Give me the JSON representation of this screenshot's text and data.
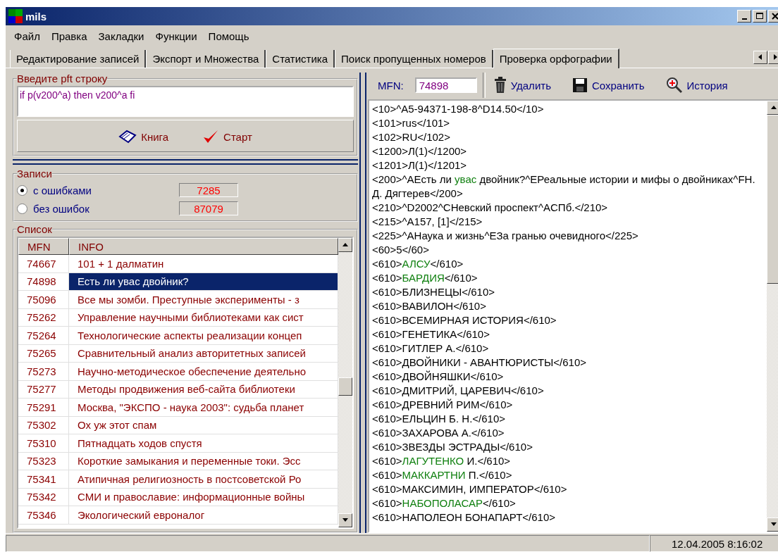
{
  "window": {
    "title": "mils"
  },
  "menu": [
    "Файл",
    "Правка",
    "Закладки",
    "Функции",
    "Помощь"
  ],
  "tabs": [
    {
      "label": "Редактирование записей",
      "selected": false
    },
    {
      "label": "Экспорт и Множества",
      "selected": false
    },
    {
      "label": "Статистика",
      "selected": false
    },
    {
      "label": "Поиск пропущенных номеров",
      "selected": false
    },
    {
      "label": "Проверка орфографии",
      "selected": true
    }
  ],
  "query": {
    "legend": "Введите pft строку",
    "value": "if p(v200^a) then v200^a fi",
    "buttons": [
      {
        "kind": "book",
        "label": "Книга"
      },
      {
        "kind": "start",
        "label": "Старт"
      }
    ]
  },
  "records": {
    "legend": "Записи",
    "options": [
      {
        "label": "с ошибками",
        "selected": true,
        "count": "7285"
      },
      {
        "label": "без ошибок",
        "selected": false,
        "count": "87079"
      }
    ]
  },
  "list": {
    "legend": "Список",
    "columns": [
      "MFN",
      "INFO"
    ],
    "rows": [
      {
        "mfn": "74667",
        "info": "101 + 1 далматин",
        "selected": false
      },
      {
        "mfn": "74898",
        "info": "Есть ли увас двойник?",
        "selected": true
      },
      {
        "mfn": "75096",
        "info": "Все мы зомби. Преступные эксперименты - з",
        "selected": false
      },
      {
        "mfn": "75262",
        "info": "Управление научными библиотеками как сист",
        "selected": false
      },
      {
        "mfn": "75264",
        "info": "Технологические аспекты реализации концеп",
        "selected": false
      },
      {
        "mfn": "75265",
        "info": "Сравнительный анализ авторитетных записей",
        "selected": false
      },
      {
        "mfn": "75273",
        "info": "Научно-методическое обеспечение деятельно",
        "selected": false
      },
      {
        "mfn": "75277",
        "info": "Методы продвижения веб-сайта библиотеки",
        "selected": false
      },
      {
        "mfn": "75291",
        "info": "Москва, \"ЭКСПО - наука 2003\": судьба планет",
        "selected": false
      },
      {
        "mfn": "75302",
        "info": "Ох уж этот спам",
        "selected": false
      },
      {
        "mfn": "75310",
        "info": "Пятнадцать ходов спустя",
        "selected": false
      },
      {
        "mfn": "75323",
        "info": "Короткие замыкания и переменные токи. Эсс",
        "selected": false
      },
      {
        "mfn": "75341",
        "info": "Атипичная религиозность в постсоветской Ро",
        "selected": false
      },
      {
        "mfn": "75342",
        "info": "СМИ и православие: информационные войны",
        "selected": false
      },
      {
        "mfn": "75346",
        "info": "Экологический евроналог",
        "selected": false
      }
    ]
  },
  "editor": {
    "mfn_label": "MFN:",
    "mfn_value": "74898",
    "buttons": [
      {
        "kind": "delete",
        "label": "Удалить"
      },
      {
        "kind": "save",
        "label": "Сохранить"
      },
      {
        "kind": "history",
        "label": "История"
      }
    ],
    "lines": [
      [
        {
          "text": "<10>^A5-94371-198-8^D14.50</10>",
          "misspelled": false
        }
      ],
      [
        {
          "text": "<101>rus</101>",
          "misspelled": false
        }
      ],
      [
        {
          "text": "<102>RU</102>",
          "misspelled": false
        }
      ],
      [
        {
          "text": "<1200>Л(1)</1200>",
          "misspelled": false
        }
      ],
      [
        {
          "text": "<1201>Л(1)</1201>",
          "misspelled": false
        }
      ],
      [
        {
          "text": "<200>^AЕсть ли ",
          "misspelled": false
        },
        {
          "text": "увас",
          "misspelled": true
        },
        {
          "text": " двойник?^EРеальные истории и мифы о двойниках^FН. Д. Дягтерев</200>",
          "misspelled": false
        }
      ],
      [
        {
          "text": "<210>^D2002^CНевский проспект^AСПб.</210>",
          "misspelled": false
        }
      ],
      [
        {
          "text": "<215>^A157, [1]</215>",
          "misspelled": false
        }
      ],
      [
        {
          "text": "<225>^AНаука и жизнь^EЗа гранью очевидного</225>",
          "misspelled": false
        }
      ],
      [
        {
          "text": "<60>5</60>",
          "misspelled": false
        }
      ],
      [
        {
          "text": "<610>",
          "misspelled": false
        },
        {
          "text": "АЛСУ",
          "misspelled": true
        },
        {
          "text": "</610>",
          "misspelled": false
        }
      ],
      [
        {
          "text": "<610>",
          "misspelled": false
        },
        {
          "text": "БАРДИЯ",
          "misspelled": true
        },
        {
          "text": "</610>",
          "misspelled": false
        }
      ],
      [
        {
          "text": "<610>БЛИЗНЕЦЫ</610>",
          "misspelled": false
        }
      ],
      [
        {
          "text": "<610>ВАВИЛОН</610>",
          "misspelled": false
        }
      ],
      [
        {
          "text": "<610>ВСЕМИРНАЯ ИСТОРИЯ</610>",
          "misspelled": false
        }
      ],
      [
        {
          "text": "<610>ГЕНЕТИКА</610>",
          "misspelled": false
        }
      ],
      [
        {
          "text": "<610>ГИТЛЕР А.</610>",
          "misspelled": false
        }
      ],
      [
        {
          "text": "<610>ДВОЙНИКИ - АВАНТЮРИСТЫ</610>",
          "misspelled": false
        }
      ],
      [
        {
          "text": "<610>ДВОЙНЯШКИ</610>",
          "misspelled": false
        }
      ],
      [
        {
          "text": "<610>ДМИТРИЙ, ЦАРЕВИЧ</610>",
          "misspelled": false
        }
      ],
      [
        {
          "text": "<610>ДРЕВНИЙ РИМ</610>",
          "misspelled": false
        }
      ],
      [
        {
          "text": "<610>ЕЛЬЦИН Б. Н.</610>",
          "misspelled": false
        }
      ],
      [
        {
          "text": "<610>ЗАХАРОВА А.</610>",
          "misspelled": false
        }
      ],
      [
        {
          "text": "<610>ЗВЕЗДЫ ЭСТРАДЫ</610>",
          "misspelled": false
        }
      ],
      [
        {
          "text": "<610>",
          "misspelled": false
        },
        {
          "text": "ЛАГУТЕНКО",
          "misspelled": true
        },
        {
          "text": " И.</610>",
          "misspelled": false
        }
      ],
      [
        {
          "text": "<610>",
          "misspelled": false
        },
        {
          "text": "МАККАРТНИ",
          "misspelled": true
        },
        {
          "text": " П.</610>",
          "misspelled": false
        }
      ],
      [
        {
          "text": "<610>МАКСИМИН, ИМПЕРАТОР</610>",
          "misspelled": false
        }
      ],
      [
        {
          "text": "<610>",
          "misspelled": false
        },
        {
          "text": "НАБОПОЛАСАР",
          "misspelled": true
        },
        {
          "text": "</610>",
          "misspelled": false
        }
      ],
      [
        {
          "text": "<610>НАПОЛЕОН БОНАПАРТ</610>",
          "misspelled": false
        }
      ]
    ]
  },
  "status_bar": {
    "datetime": "12.04.2005 8:16:02"
  }
}
